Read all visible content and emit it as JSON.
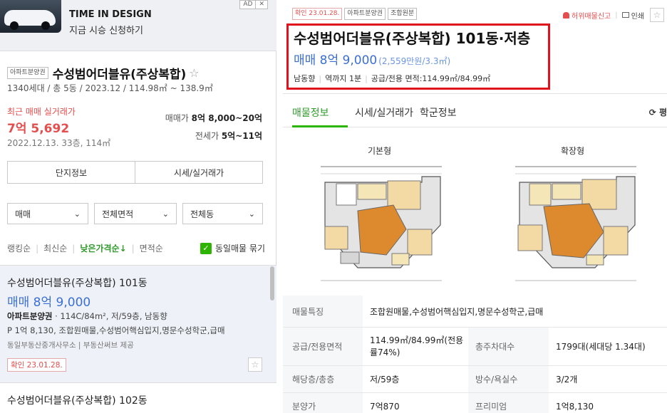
{
  "ad": {
    "label": "AD",
    "close": "✕",
    "title": "TIME IN DESIGN",
    "subtitle": "지금 시승 신청하기"
  },
  "complex": {
    "badge": "아파트분양권",
    "name": "수성범어더블유(주상복합)",
    "star": "☆",
    "info": "1340세대 / 총 5동 / 2023.12 / 114.98㎡ ~ 138.9㎡",
    "recent_label": "최근 매매 실거래가",
    "recent_price": "7억 5,692",
    "recent_date": "2022.12.13. 33층, 114㎡",
    "sale_label": "매매가",
    "sale_range": "8억 8,000~20억",
    "jeonse_label": "전세가",
    "jeonse_range": "5억~11억"
  },
  "buttons": {
    "complex_info": "단지정보",
    "market_price": "시세/실거래가"
  },
  "filters": [
    {
      "label": "매매"
    },
    {
      "label": "전체면적"
    },
    {
      "label": "전체동"
    }
  ],
  "sort": {
    "options": [
      "랭킹순",
      "최신순",
      "낮은가격순↓",
      "면적순"
    ],
    "bundle_label": "동일매물 묶기",
    "check_mark": "✓"
  },
  "listing1": {
    "title": "수성범어더블유(주상복합) 101동",
    "price": "매매 8억 9,000",
    "type": "아파트분양권",
    "spec": " · 114C/84m², 저/59층, 남동향",
    "feature": "P 1억 8,130, 조합원매물,수성범어핵심입지,명문수성학군,급매",
    "agent": "동일부동산중개사무소 | 부동산써브 제공",
    "confirm": "확인 23.01.28.",
    "fav": "☆"
  },
  "listing2": {
    "title": "수성범어더블유(주상복합) 102동"
  },
  "detail": {
    "confirm": "확인 23.01.28.",
    "tag1": "아파트분양권",
    "tag2": "조합원분",
    "report": "허위매물신고",
    "print": "인쇄",
    "fav": "☆",
    "title": "수성범어더블유(주상복합) 101동·저층",
    "price": "매매 8억 9,000",
    "price_unit": "(2,559만원/3.3㎡)",
    "direction": "남동향",
    "distance": "역까지 1분",
    "area": "공급/전용 면적:114.99㎡/84.99㎡"
  },
  "tabs": {
    "listing": "매물정보",
    "market": "시세/실거래가",
    "school": "학군정보",
    "refresh": "⟳ 평"
  },
  "plans": {
    "basic": "기본형",
    "extended": "확장형"
  },
  "table": {
    "feature_key": "매물특징",
    "feature_val": "조합원매물,수성범어핵심입지,명문수성학군,급매",
    "area_key": "공급/전용면적",
    "area_val": "114.99㎡/84.99㎡(전용률74%)",
    "parking_key": "총주차대수",
    "parking_val": "1799대(세대당 1.34대)",
    "floor_key": "해당층/총층",
    "floor_val": "저/59층",
    "rooms_key": "방수/욕실수",
    "rooms_val": "3/2개",
    "presale_key": "분양가",
    "presale_val": "7억870",
    "premium_key": "프리미엄",
    "premium_val": "1억8,130"
  }
}
